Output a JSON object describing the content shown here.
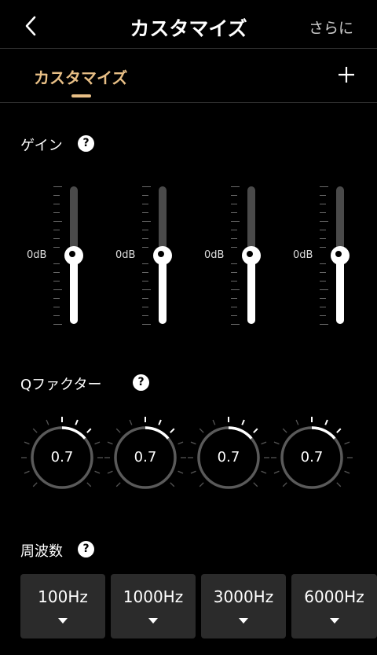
{
  "header": {
    "title": "カスタマイズ",
    "more_label": "さらに",
    "back_icon": "chevron-left-icon"
  },
  "tabs": [
    {
      "label": "カスタマイズ",
      "active": true
    }
  ],
  "add_icon": "plus-icon",
  "colors": {
    "accent": "#e8bf86",
    "background": "#000000",
    "track": "#4a4a4a",
    "card": "#2b2b2b"
  },
  "gain": {
    "label": "ゲイン",
    "help_label": "?",
    "sliders": [
      {
        "db_label": "0dB",
        "level": 0.5
      },
      {
        "db_label": "0dB",
        "level": 0.5
      },
      {
        "db_label": "0dB",
        "level": 0.5
      },
      {
        "db_label": "0dB",
        "level": 0.5
      }
    ]
  },
  "q_factor": {
    "label": "Qファクター",
    "help_label": "?",
    "knobs": [
      {
        "value": "0.7"
      },
      {
        "value": "0.7"
      },
      {
        "value": "0.7"
      },
      {
        "value": "0.7"
      }
    ]
  },
  "frequency": {
    "label": "周波数",
    "help_label": "?",
    "bands": [
      {
        "value": "100Hz"
      },
      {
        "value": "1000Hz"
      },
      {
        "value": "3000Hz"
      },
      {
        "value": "6000Hz"
      }
    ]
  }
}
